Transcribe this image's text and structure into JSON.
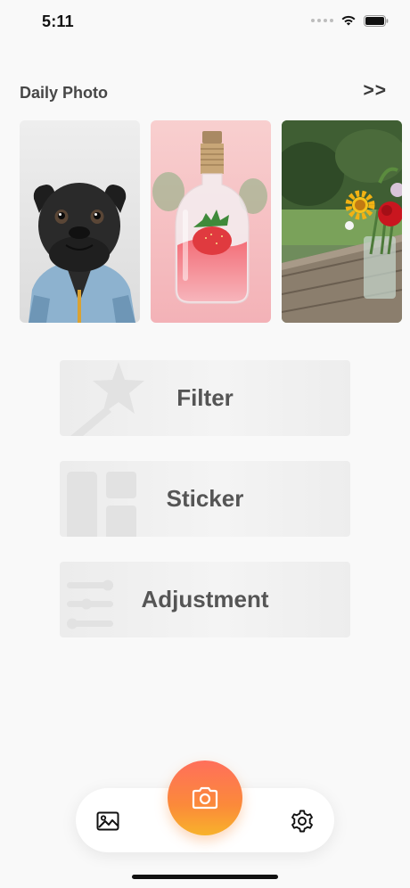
{
  "status_bar": {
    "time": "5:11"
  },
  "daily_photo": {
    "title": "Daily Photo",
    "more_label": ">>",
    "photos": [
      {
        "name": "pug-photo"
      },
      {
        "name": "strawberry-bottle-photo"
      },
      {
        "name": "flowers-photo"
      }
    ]
  },
  "tools": [
    {
      "label": "Filter",
      "icon": "magic-wand-star-icon"
    },
    {
      "label": "Sticker",
      "icon": "layout-grid-icon"
    },
    {
      "label": "Adjustment",
      "icon": "sliders-icon"
    }
  ],
  "bottom_nav": {
    "items": [
      "gallery-icon",
      "camera-icon",
      "settings-icon"
    ]
  },
  "colors": {
    "camera_gradient_top": "#ff6f5b",
    "camera_gradient_bottom": "#f8b22b",
    "background": "#f9f9f9"
  }
}
